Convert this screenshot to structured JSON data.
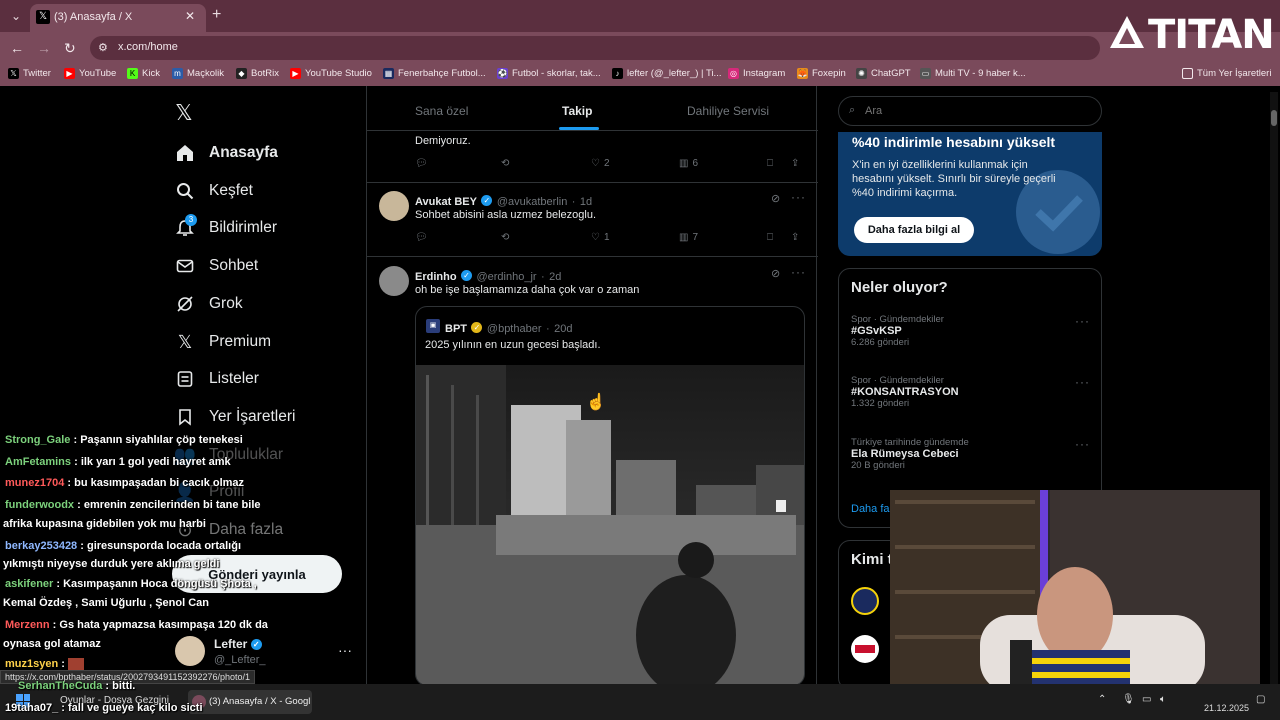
{
  "browser": {
    "tab_title": "(3) Anasayfa / X",
    "url": "x.com/home",
    "overlay_logo": "TITAN",
    "bookmarks": [
      "Twitter",
      "YouTube",
      "Kick",
      "Maçkolik",
      "BotRix",
      "YouTube Studio",
      "Fenerbahçe Futbol...",
      "Futbol - skorlar, tak...",
      "lefter (@_lefter_) | Ti...",
      "Instagram",
      "Foxepin",
      "ChatGPT",
      "Multi TV - 9 haber k..."
    ],
    "all_bookmarks": "Tüm Yer İşaretleri"
  },
  "sidebar": {
    "items": [
      {
        "label": "Anasayfa",
        "icon": "home-icon"
      },
      {
        "label": "Keşfet",
        "icon": "search-icon"
      },
      {
        "label": "Bildirimler",
        "icon": "bell-icon",
        "badge": "3"
      },
      {
        "label": "Sohbet",
        "icon": "mail-icon"
      },
      {
        "label": "Grok",
        "icon": "grok-icon"
      },
      {
        "label": "Premium",
        "icon": "x-icon"
      },
      {
        "label": "Listeler",
        "icon": "list-icon"
      },
      {
        "label": "Yer İşaretleri",
        "icon": "bookmark-icon"
      },
      {
        "label": "Topluluklar",
        "icon": "people-icon"
      },
      {
        "label": "Profil",
        "icon": "person-icon"
      },
      {
        "label": "Daha fazla",
        "icon": "more-icon"
      }
    ],
    "post_button": "Gönderi yayınla",
    "account": {
      "name": "Lefter",
      "handle": "@_Lefter_"
    }
  },
  "feed": {
    "tabs": [
      "Sana özel",
      "Takip",
      "Dahiliye Servisi"
    ],
    "active_tab": "Takip",
    "tweet0": {
      "text": "Demiyoruz.",
      "likes": "2",
      "views": "6"
    },
    "tweet1": {
      "name": "Avukat BEY",
      "handle": "@avukatberlin",
      "time": "1d",
      "text": "Sohbet abisini asla uzmez belezoglu.",
      "likes": "1",
      "views": "7"
    },
    "tweet2": {
      "name": "Erdinho",
      "handle": "@erdinho_jr",
      "time": "2d",
      "text": "oh be işe başlamamıza daha çok var o zaman",
      "quote": {
        "name": "BPT",
        "handle": "@bpthaber",
        "time": "20d",
        "text": "2025 yılının en uzun gecesi başladı."
      }
    }
  },
  "right": {
    "search_placeholder": "Ara",
    "promo": {
      "title": "%40 indirimle hesabını yükselt",
      "body": "X'in en iyi özelliklerini kullanmak için hesabını yükselt. Sınırlı bir süreyle geçerli %40 indirimi kaçırma.",
      "button": "Daha fazla bilgi al"
    },
    "trends_title": "Neler oluyor?",
    "trends": [
      {
        "cat": "Spor · Gündemdekiler",
        "title": "#GSvKSP",
        "count": "6.286 gönderi"
      },
      {
        "cat": "Spor · Gündemdekiler",
        "title": "#KONSANTRASYON",
        "count": "1.332 gönderi"
      },
      {
        "cat": "Türkiye tarihinde gündemde",
        "title": "Ela Rümeysa Cebeci",
        "count": "20 B gönderi"
      }
    ],
    "show_more": "Daha fa",
    "who_title": "Kimi t"
  },
  "chat": [
    {
      "user": "Strong_Gale",
      "color": "#7cd17c",
      "msg": "Paşanın siyahlılar çöp tenekesi"
    },
    {
      "user": "AmFetamins",
      "color": "#7cd17c",
      "msg": "ilk yarı 1 gol yedi hayret amk"
    },
    {
      "user": "munez1704",
      "color": "#ff5a5a",
      "msg": "bu kasımpaşadan bi cacık olmaz"
    },
    {
      "user": "funderwoodx",
      "color": "#7cd17c",
      "msg": "emrenin zencilerinden bi tane bile"
    },
    {
      "user": "",
      "color": "#ffffff",
      "msg": "afrika kupasına gidebilen yok mu harbi"
    },
    {
      "user": "berkay253428",
      "color": "#8fb8ff",
      "msg": "giresunsporda locada ortalığı"
    },
    {
      "user": "",
      "color": "#ffffff",
      "msg": "yıkmıştı niyeyse durduk yere aklıma geldi"
    },
    {
      "user": "askifener",
      "color": "#7cd17c",
      "msg": "Kasımpaşanın Hoca döngüsü Şhota ,"
    },
    {
      "user": "",
      "color": "#ffffff",
      "msg": "Kemal Özdeş , Sami Uğurlu , Şenol Can"
    },
    {
      "user": "Merzenn",
      "color": "#ff5a5a",
      "msg": "Gs hata yapmazsa kasımpaşa 120 dk da"
    },
    {
      "user": "",
      "color": "#ffffff",
      "msg": "oynasa gol atamaz"
    },
    {
      "user": "muz1syen",
      "color": "#ffd24a",
      "msg": ""
    },
    {
      "user": "SerhanTheCuda",
      "color": "#7cd17c",
      "msg": "bitti."
    },
    {
      "user": "19taha07_",
      "color": "#ffffff",
      "msg": "fall ve gueye kaç kilo sicti"
    }
  ],
  "status_url": "https://x.com/bpthaber/status/2002793491152392276/photo/1",
  "taskbar": {
    "items": [
      "Oyunlar - Dosya Gezgini",
      "(3) Anasayfa / X - Googl"
    ],
    "date": "21.12.2025"
  }
}
